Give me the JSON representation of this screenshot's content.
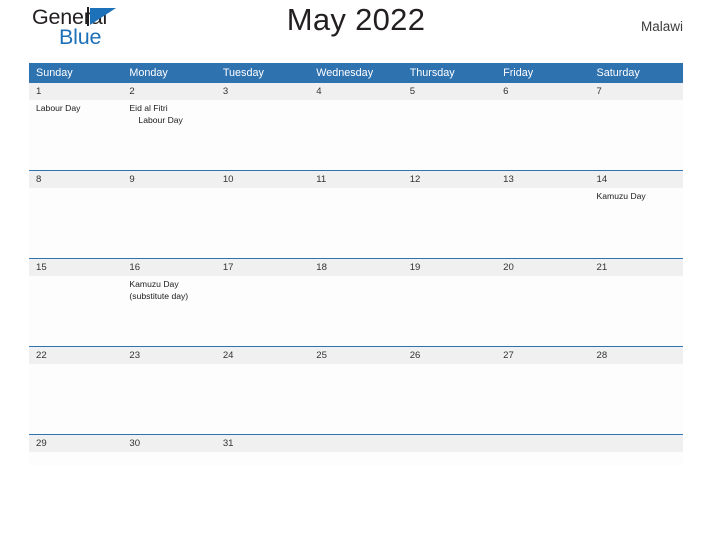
{
  "brand": {
    "name_part1": "General",
    "name_part2": "Blue",
    "flag_icon": "flag-triangle-icon"
  },
  "header": {
    "title": "May 2022",
    "country": "Malawi"
  },
  "calendar": {
    "weekday_headers": [
      "Sunday",
      "Monday",
      "Tuesday",
      "Wednesday",
      "Thursday",
      "Friday",
      "Saturday"
    ],
    "weeks": [
      {
        "dates": [
          "1",
          "2",
          "3",
          "4",
          "5",
          "6",
          "7"
        ],
        "events": [
          [
            "Labour Day"
          ],
          [
            "Eid al Fitri",
            "Labour Day"
          ],
          [],
          [],
          [],
          [],
          []
        ]
      },
      {
        "dates": [
          "8",
          "9",
          "10",
          "11",
          "12",
          "13",
          "14"
        ],
        "events": [
          [],
          [],
          [],
          [],
          [],
          [],
          [
            "Kamuzu Day"
          ]
        ]
      },
      {
        "dates": [
          "15",
          "16",
          "17",
          "18",
          "19",
          "20",
          "21"
        ],
        "events": [
          [],
          [
            "Kamuzu Day",
            "(substitute day)"
          ],
          [],
          [],
          [],
          [],
          []
        ]
      },
      {
        "dates": [
          "22",
          "23",
          "24",
          "25",
          "26",
          "27",
          "28"
        ],
        "events": [
          [],
          [],
          [],
          [],
          [],
          [],
          []
        ]
      },
      {
        "dates": [
          "29",
          "30",
          "31",
          "",
          "",
          "",
          ""
        ],
        "events": [
          [],
          [],
          [],
          [],
          [],
          [],
          []
        ]
      }
    ]
  },
  "colors": {
    "header_blue": "#2e72b0",
    "brand_blue": "#1d71b8",
    "date_band": "#f0f0f0",
    "text_dark": "#231f20"
  }
}
